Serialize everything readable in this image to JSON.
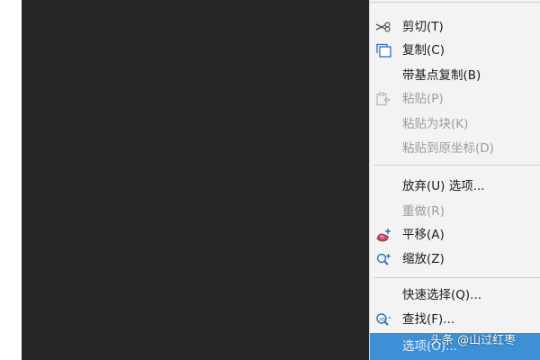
{
  "menu": {
    "items": [
      {
        "label": "剪切(T)",
        "icon": "scissors-icon",
        "disabled": false
      },
      {
        "label": "复制(C)",
        "icon": "copy-icon",
        "disabled": false
      },
      {
        "label": "带基点复制(B)",
        "icon": "",
        "disabled": false
      },
      {
        "label": "粘贴(P)",
        "icon": "paste-icon",
        "disabled": true
      },
      {
        "label": "粘贴为块(K)",
        "icon": "",
        "disabled": true
      },
      {
        "label": "粘贴到原坐标(D)",
        "icon": "",
        "disabled": true
      },
      {
        "label": "放弃(U) 选项...",
        "icon": "",
        "disabled": false
      },
      {
        "label": "重做(R)",
        "icon": "",
        "disabled": true
      },
      {
        "label": "平移(A)",
        "icon": "pan-icon",
        "disabled": false
      },
      {
        "label": "缩放(Z)",
        "icon": "zoom-icon",
        "disabled": false
      },
      {
        "label": "快速选择(Q)...",
        "icon": "",
        "disabled": false
      },
      {
        "label": "查找(F)...",
        "icon": "find-icon",
        "disabled": false
      },
      {
        "label": "选项(O)...",
        "icon": "",
        "disabled": false,
        "selected": true
      }
    ]
  },
  "watermark": "头条 @山过红枣",
  "colors": {
    "canvas_bg": "#252525",
    "menu_bg": "#f3f3f3",
    "highlight": "#3d8fd6",
    "disabled_text": "#9c9c9c"
  }
}
